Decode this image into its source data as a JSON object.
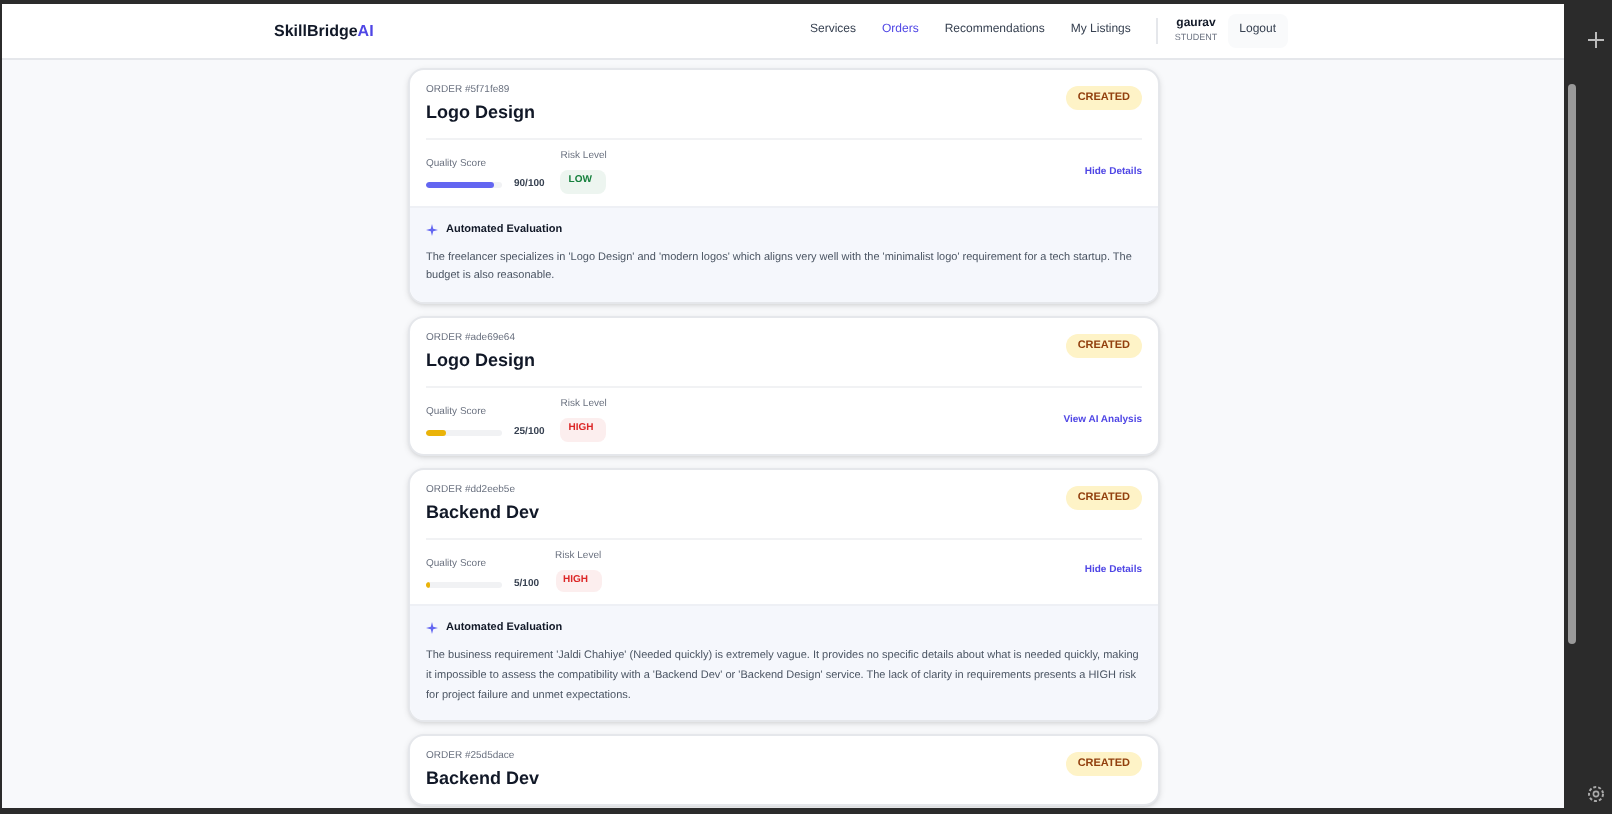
{
  "brand": {
    "name": "SkillBridge",
    "accent": "AI"
  },
  "nav": [
    {
      "label": "Services",
      "selected": false
    },
    {
      "label": "Orders",
      "selected": true
    },
    {
      "label": "Recommendations",
      "selected": false
    },
    {
      "label": "My Listings",
      "selected": false
    }
  ],
  "user": {
    "name": "gaurav",
    "role": "STUDENT"
  },
  "logout": "Logout",
  "orders": [
    {
      "order_id": "ORDER #5f71fe89",
      "title": "Logo Design",
      "status": "CREATED",
      "score_label": "Quality Score",
      "level": 0.9,
      "score": "90/100",
      "risk_label": "Risk Level",
      "risk": {
        "text": "LOW",
        "color": "#15803d"
      },
      "action": "Hide Details",
      "expanded": true,
      "evaluation_title": "Automated Evaluation",
      "evaluation": "The freelancer specializes in 'Logo Design' and 'modern logos' which aligns very well with the 'minimalist logo' requirement for a tech startup. The budget is also reasonable."
    },
    {
      "order_id": "ORDER #ade69e64",
      "title": "Logo Design",
      "status": "CREATED",
      "score_label": "Quality Score",
      "level": 0.25,
      "score": "25/100",
      "risk_label": "Risk Level",
      "risk": {
        "text": "HIGH",
        "color": "#dc2626"
      },
      "action": "View AI Analysis",
      "expanded": false
    },
    {
      "order_id": "ORDER #dd2eeb5e",
      "title": "Backend Dev",
      "status": "CREATED",
      "score_label": "Quality Score",
      "level": 0.05,
      "score": "5/100",
      "risk_label": "Risk Level",
      "risk": {
        "text": "HIGH",
        "color": "#dc2626"
      },
      "action": "Hide Details",
      "expanded": true,
      "evaluation_title": "Automated Evaluation",
      "evaluation": "The business requirement 'Jaldi Chahiye' (Needed quickly) is extremely vague. It provides no specific details about what is needed quickly, making it impossible to assess the compatibility with a 'Backend Dev' or 'Backend Design' service. The lack of clarity in requirements presents a HIGH risk for project failure and unmet expectations."
    },
    {
      "order_id": "ORDER #25d5dace",
      "title": "Backend Dev",
      "status": "CREATED"
    }
  ]
}
